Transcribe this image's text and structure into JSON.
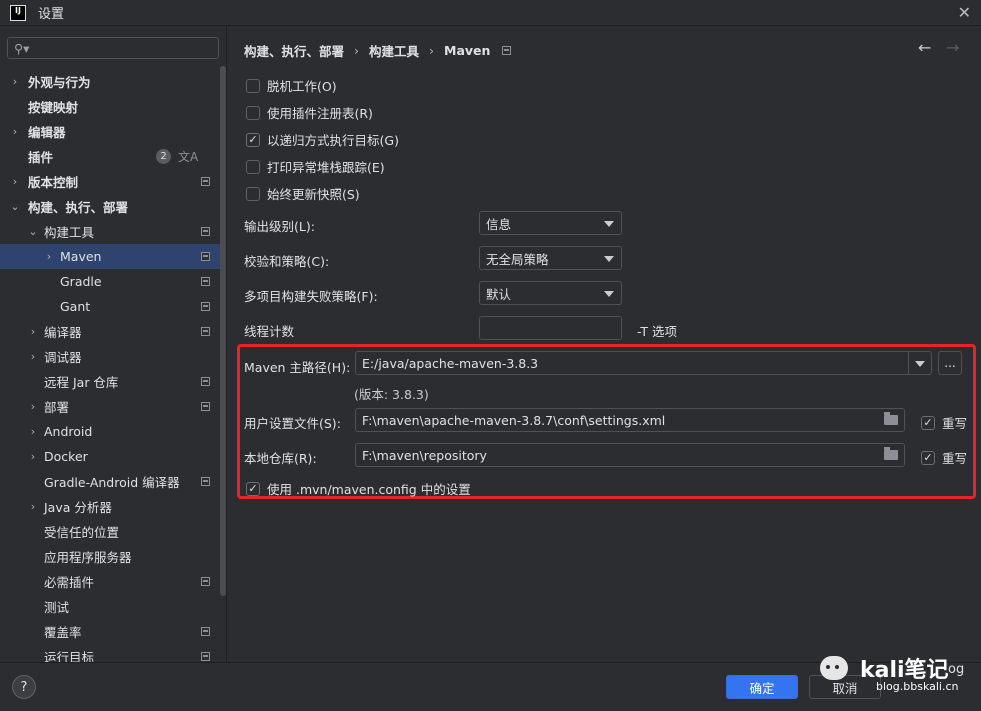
{
  "window": {
    "title": "设置",
    "logo_text": "IJ",
    "close_glyph": "✕"
  },
  "sidebar": {
    "search_placeholder": "",
    "items": [
      {
        "label": "外观与行为",
        "chevron": "›",
        "bold": true
      },
      {
        "label": "按键映射",
        "chevron": "",
        "bold": true
      },
      {
        "label": "编辑器",
        "chevron": "›",
        "bold": true
      },
      {
        "label": "插件",
        "chevron": "",
        "bold": true,
        "badge": "2"
      },
      {
        "label": "版本控制",
        "chevron": "›",
        "bold": true
      },
      {
        "label": "构建、执行、部署",
        "chevron": "⌄",
        "bold": true
      },
      {
        "label": "构建工具",
        "chevron": "⌄"
      },
      {
        "label": "Maven",
        "chevron": "›"
      },
      {
        "label": "Gradle",
        "chevron": ""
      },
      {
        "label": "Gant",
        "chevron": ""
      },
      {
        "label": "编译器",
        "chevron": "›"
      },
      {
        "label": "调试器",
        "chevron": "›"
      },
      {
        "label": "远程 Jar 仓库",
        "chevron": ""
      },
      {
        "label": "部署",
        "chevron": "›"
      },
      {
        "label": "Android",
        "chevron": "›"
      },
      {
        "label": "Docker",
        "chevron": "›"
      },
      {
        "label": "Gradle-Android 编译器",
        "chevron": ""
      },
      {
        "label": "Java 分析器",
        "chevron": "›"
      },
      {
        "label": "受信任的位置",
        "chevron": ""
      },
      {
        "label": "应用程序服务器",
        "chevron": ""
      },
      {
        "label": "必需插件",
        "chevron": ""
      },
      {
        "label": "测试",
        "chevron": ""
      },
      {
        "label": "覆盖率",
        "chevron": ""
      },
      {
        "label": "运行目标",
        "chevron": ""
      }
    ]
  },
  "breadcrumb": {
    "part1": "构建、执行、部署",
    "part2": "构建工具",
    "part3": "Maven",
    "sep": "›"
  },
  "nav": {
    "back": "←",
    "forward": "→"
  },
  "options": {
    "offline": {
      "label": "脱机工作(O)",
      "checked": false
    },
    "plugin_registry": {
      "label": "使用插件注册表(R)",
      "checked": false
    },
    "recursive": {
      "label": "以递归方式执行目标(G)",
      "checked": true
    },
    "stacktrace": {
      "label": "打印异常堆栈跟踪(E)",
      "checked": false
    },
    "snapshots": {
      "label": "始终更新快照(S)",
      "checked": false
    }
  },
  "form": {
    "output_level_label": "输出级别(L):",
    "output_level_value": "信息",
    "checksum_label": "校验和策略(C):",
    "checksum_value": "无全局策略",
    "failure_label": "多项目构建失败策略(F):",
    "failure_value": "默认",
    "threads_label": "线程计数",
    "threads_value": "",
    "threads_suffix": "-T 选项"
  },
  "maven": {
    "home_label": "Maven 主路径(H):",
    "home_value": "E:/java/apache-maven-3.8.3",
    "browse": "...",
    "version": "(版本: 3.8.3)",
    "settings_label": "用户设置文件(S):",
    "settings_value": "F:\\maven\\apache-maven-3.8.7\\conf\\settings.xml",
    "repo_label": "本地仓库(R):",
    "repo_value": "F:\\maven\\repository",
    "override_label": "重写",
    "use_config_label": "使用 .mvn/maven.config 中的设置"
  },
  "footer": {
    "help": "?",
    "ok": "确定",
    "cancel": "取消"
  },
  "watermark": {
    "title": "kali笔记",
    "tail": "og",
    "sub": "blog.bbskali.cn"
  },
  "colors": {
    "accent": "#3574f0",
    "selection": "#2e436e",
    "highlight": "#e8242a"
  }
}
